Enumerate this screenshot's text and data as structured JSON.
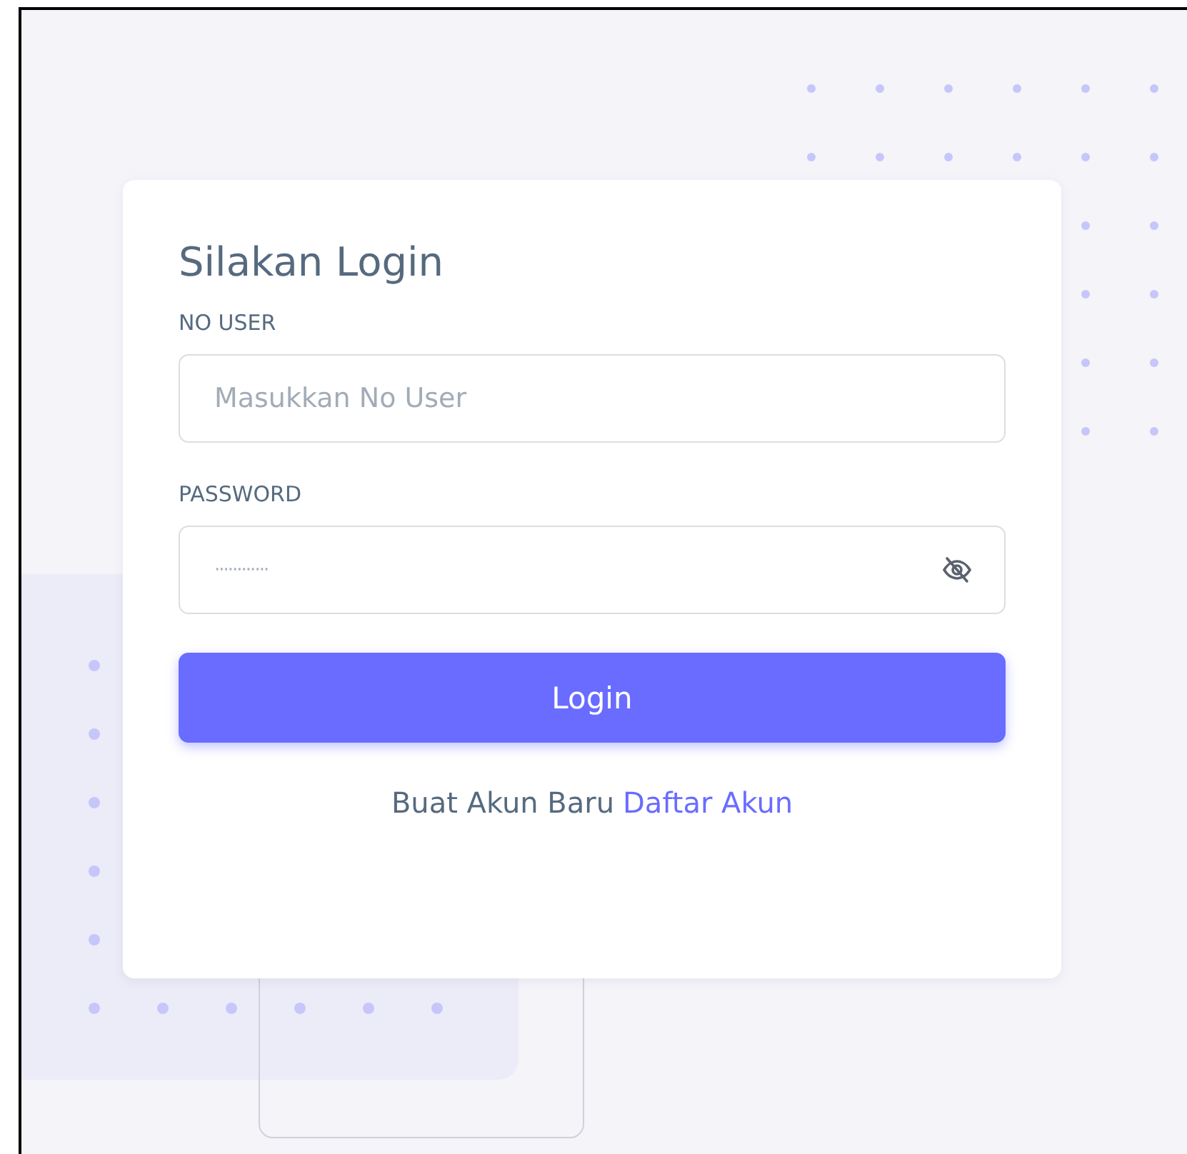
{
  "login_card": {
    "title": "Silakan Login",
    "fields": [
      {
        "kind": "text",
        "label": "NO USER",
        "placeholder": "Masukkan No User"
      },
      {
        "kind": "password",
        "label": "PASSWORD",
        "value": "············",
        "reveal_toggle": true
      }
    ],
    "login_button": "Login",
    "register_prompt": {
      "text": "Buat Akun Baru",
      "link": "Daftar Akun"
    }
  }
}
